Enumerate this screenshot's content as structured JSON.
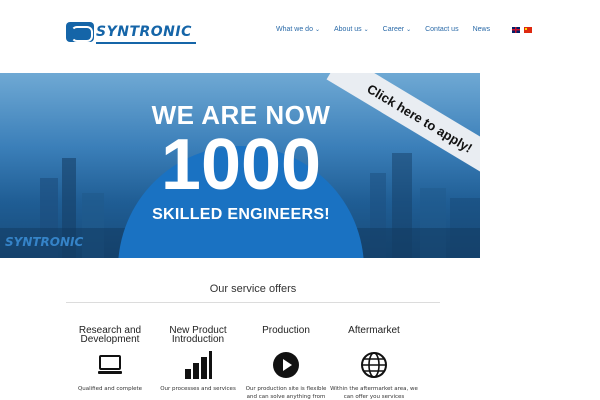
{
  "header": {
    "logo_text": "SYNTRONIC",
    "nav": [
      {
        "label": "What we do",
        "has_dropdown": true
      },
      {
        "label": "About us",
        "has_dropdown": true
      },
      {
        "label": "Career",
        "has_dropdown": true
      },
      {
        "label": "Contact us",
        "has_dropdown": false
      },
      {
        "label": "News",
        "has_dropdown": false
      }
    ],
    "languages": [
      "english-flag-icon",
      "chinese-flag-icon"
    ]
  },
  "banner": {
    "line1": "WE ARE NOW",
    "line2": "1000",
    "line3": "SKILLED ENGINEERS!",
    "ribbon": "Click here to apply!",
    "watermark": "SYNTRONIC",
    "colors": {
      "circle": "#1a72c2",
      "ribbon": "#e9edf2"
    }
  },
  "services": {
    "title": "Our service offers",
    "items": [
      {
        "title": "Research and Development",
        "icon": "laptop-icon",
        "desc": "Qualified and complete"
      },
      {
        "title": "New Product Introduction",
        "icon": "bar-chart-icon",
        "desc": "Our processes and services"
      },
      {
        "title": "Production",
        "icon": "play-icon",
        "desc": "Our production site is flexible and can solve anything from"
      },
      {
        "title": "Aftermarket",
        "icon": "globe-icon",
        "desc": "Within the aftermarket area, we can offer you services"
      }
    ]
  },
  "colors": {
    "brand": "#1565a8",
    "nav": "#2a6aa8"
  }
}
